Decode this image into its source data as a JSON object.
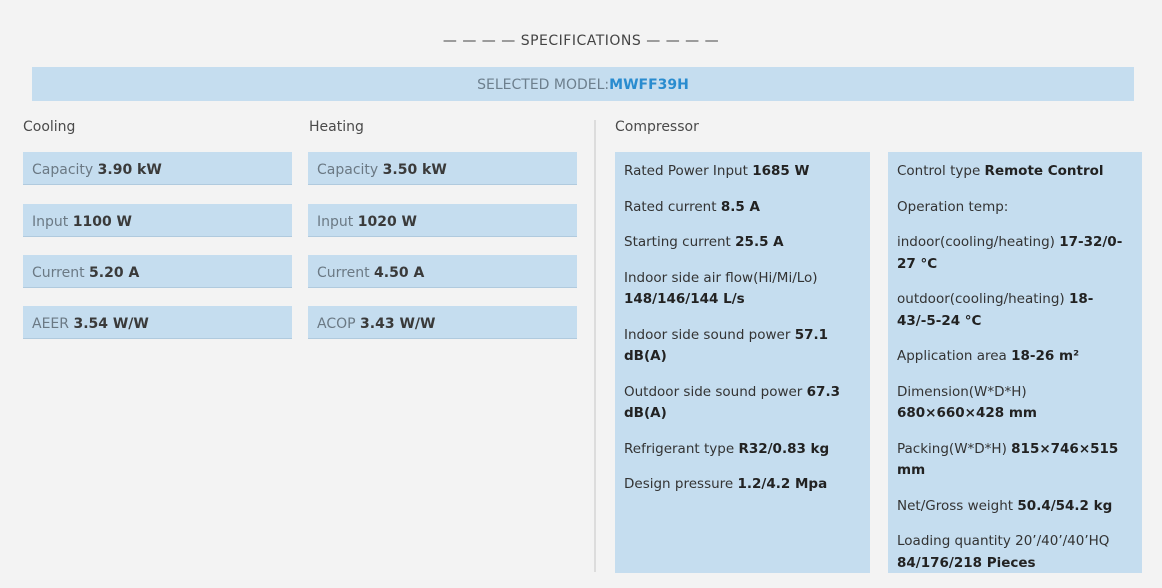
{
  "header": {
    "title": "— — — — SPECIFICATIONS — — — —"
  },
  "model": {
    "label": "SELECTED MODEL:",
    "code": "MWFF39H"
  },
  "cooling": {
    "heading": "Cooling",
    "items": [
      {
        "label": "Capacity",
        "value": "3.90 kW"
      },
      {
        "label": "Input",
        "value": "1100 W"
      },
      {
        "label": "Current",
        "value": "5.20 A"
      },
      {
        "label": "AEER",
        "value": "3.54 W/W"
      }
    ]
  },
  "heating": {
    "heading": "Heating",
    "items": [
      {
        "label": "Capacity",
        "value": "3.50 kW"
      },
      {
        "label": "Input",
        "value": "1020 W"
      },
      {
        "label": "Current",
        "value": "4.50 A"
      },
      {
        "label": "ACOP",
        "value": "3.43 W/W"
      }
    ]
  },
  "compressor": {
    "heading": "Compressor",
    "items": [
      {
        "label": "Rated Power Input",
        "value": "1685 W"
      },
      {
        "label": "Rated current",
        "value": "8.5 A"
      },
      {
        "label": "Starting current",
        "value": "25.5 A"
      },
      {
        "label": "Indoor side air flow(Hi/Mi/Lo)",
        "value": "148/146/144 L/s"
      },
      {
        "label": "Indoor side sound power",
        "value": "57.1 dB(A)"
      },
      {
        "label": "Outdoor side sound power",
        "value": "67.3 dB(A)"
      },
      {
        "label": "Refrigerant type",
        "value": "R32/0.83 kg"
      },
      {
        "label": "Design pressure",
        "value": "1.2/4.2 Mpa"
      }
    ]
  },
  "other": {
    "items": [
      {
        "label": "Control type",
        "value": "Remote Control"
      },
      {
        "label": "Operation temp:",
        "value": ""
      },
      {
        "label": "indoor(cooling/heating)",
        "value": "17-32/0-27 °C"
      },
      {
        "label": "outdoor(cooling/heating)",
        "value": "18-43/-5-24 °C"
      },
      {
        "label": "Application area",
        "value": "18-26 m²"
      },
      {
        "label": "Dimension(W*D*H)",
        "value": "680×660×428 mm"
      },
      {
        "label": "Packing(W*D*H)",
        "value": "815×746×515 mm"
      },
      {
        "label": "Net/Gross weight",
        "value": "50.4/54.2 kg"
      },
      {
        "label": "Loading quantity 20’/40’/40’HQ",
        "value": "84/176/218 Pieces"
      }
    ]
  }
}
